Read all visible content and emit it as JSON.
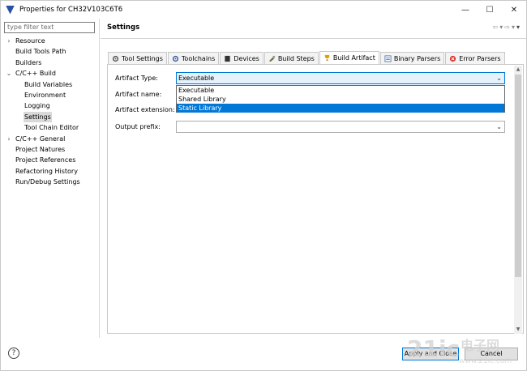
{
  "window": {
    "title": "Properties for CH32V103C6T6"
  },
  "filter": {
    "placeholder": "type filter text"
  },
  "tree": [
    {
      "label": "Resource",
      "expander": "›"
    },
    {
      "label": "Build Tools Path",
      "expander": ""
    },
    {
      "label": "Builders",
      "expander": ""
    },
    {
      "label": "C/C++ Build",
      "expander": "⌄"
    },
    {
      "label": "Build Variables",
      "expander": ""
    },
    {
      "label": "Environment",
      "expander": ""
    },
    {
      "label": "Logging",
      "expander": ""
    },
    {
      "label": "Settings",
      "expander": ""
    },
    {
      "label": "Tool Chain Editor",
      "expander": ""
    },
    {
      "label": "C/C++ General",
      "expander": "›"
    },
    {
      "label": "Project Natures",
      "expander": ""
    },
    {
      "label": "Project References",
      "expander": ""
    },
    {
      "label": "Refactoring History",
      "expander": ""
    },
    {
      "label": "Run/Debug Settings",
      "expander": ""
    }
  ],
  "page": {
    "title": "Settings"
  },
  "tabs": [
    {
      "label": "Tool Settings",
      "icon": "tool-settings-icon"
    },
    {
      "label": "Toolchains",
      "icon": "toolchains-icon"
    },
    {
      "label": "Devices",
      "icon": "devices-icon"
    },
    {
      "label": "Build Steps",
      "icon": "build-steps-icon"
    },
    {
      "label": "Build Artifact",
      "icon": "build-artifact-icon"
    },
    {
      "label": "Binary Parsers",
      "icon": "binary-parsers-icon"
    },
    {
      "label": "Error Parsers",
      "icon": "error-parsers-icon"
    }
  ],
  "form": {
    "artifact_type_label": "Artifact Type:",
    "artifact_type_value": "Executable",
    "artifact_name_label": "Artifact name:",
    "artifact_extension_label": "Artifact extension:",
    "output_prefix_label": "Output prefix:",
    "output_prefix_value": ""
  },
  "dropdown": {
    "options": [
      "Executable",
      "Shared Library",
      "Static Library"
    ],
    "highlighted": "Static Library"
  },
  "footer": {
    "help": "?",
    "apply_close": "Apply and Close",
    "cancel": "Cancel"
  },
  "watermark": {
    "text": "21ic",
    "cn": "电子网",
    "site": "www.21ic.com"
  },
  "colors": {
    "accent": "#0078d7",
    "selection": "#d9d9d9"
  }
}
